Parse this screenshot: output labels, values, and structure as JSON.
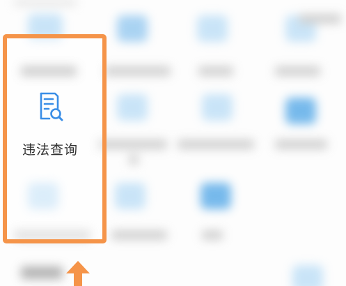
{
  "highlighted_item": {
    "label": "违法查询",
    "icon": "document-search-icon"
  },
  "colors": {
    "highlight_border": "#f59449",
    "arrow": "#f59449",
    "icon_blue": "#3a8ee6",
    "label_text": "#333333"
  }
}
